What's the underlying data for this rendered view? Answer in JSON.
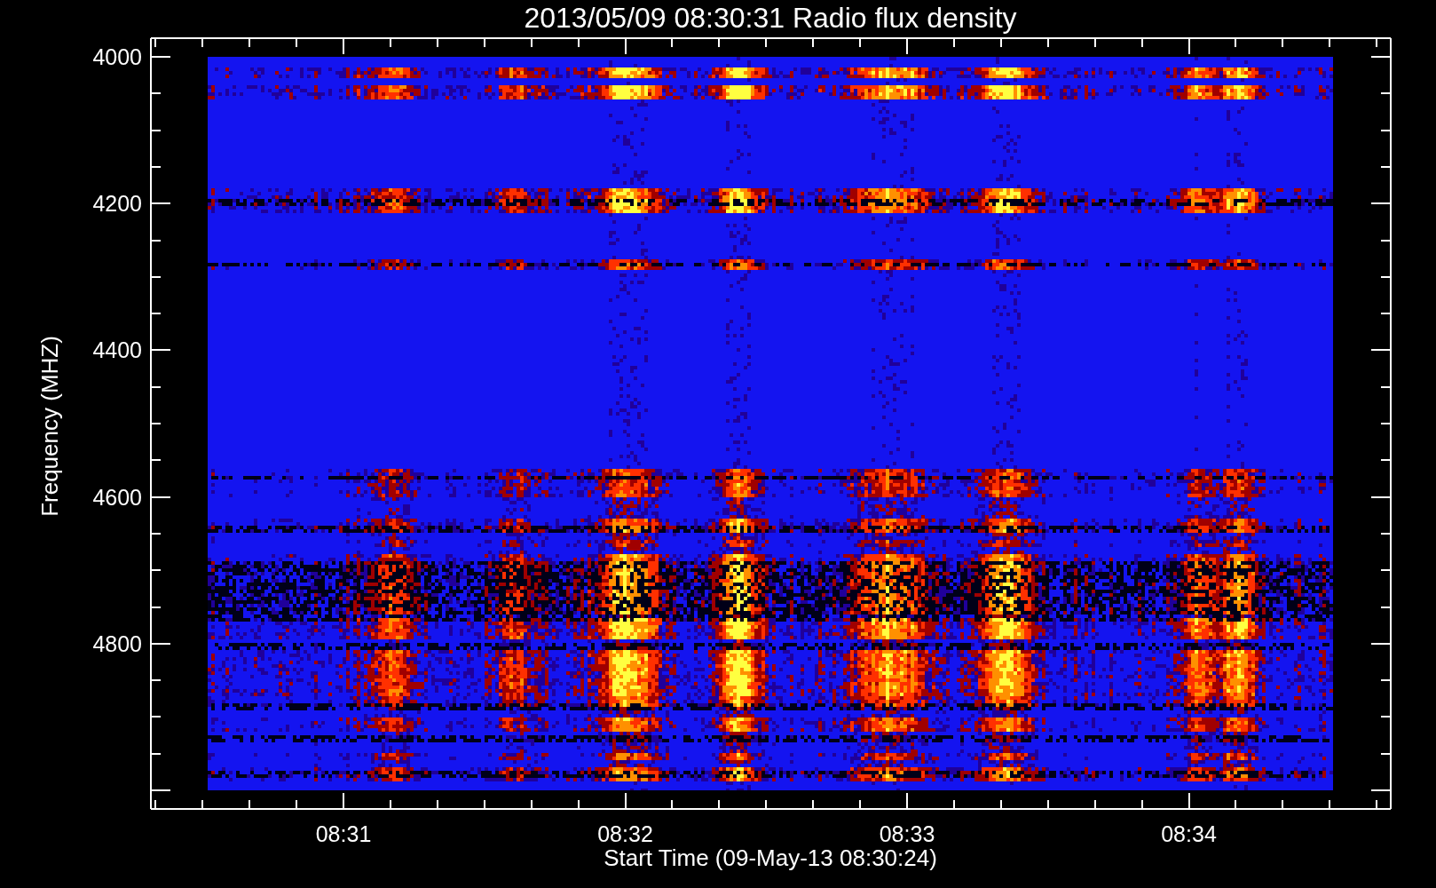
{
  "title": "2013/05/09 08:30:31 Radio flux density",
  "y_axis": {
    "label": "Frequency (MHZ)",
    "ticks": [
      "4000",
      "4200",
      "4400",
      "4600",
      "4800"
    ]
  },
  "x_axis": {
    "label": "Start Time (09-May-13 08:30:24)",
    "ticks": [
      "08:31",
      "08:32",
      "08:33",
      "08:34"
    ]
  }
}
